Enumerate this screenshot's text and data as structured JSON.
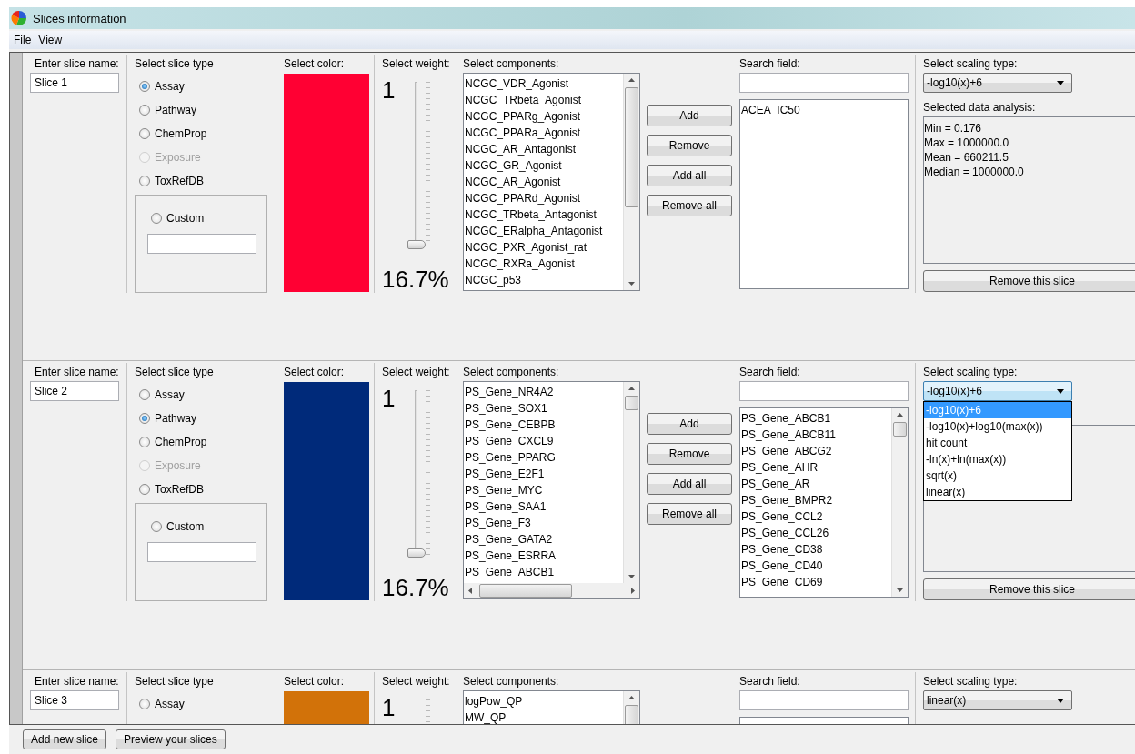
{
  "window": {
    "title": "Slices information"
  },
  "menu": [
    "File",
    "View"
  ],
  "slices": [
    {
      "name_label": "Enter slice name:",
      "name": "Slice 1",
      "type_label": "Select slice type",
      "types": [
        {
          "label": "Assay",
          "selected": true,
          "disabled": false
        },
        {
          "label": "Pathway",
          "selected": false,
          "disabled": false
        },
        {
          "label": "ChemProp",
          "selected": false,
          "disabled": false
        },
        {
          "label": "Exposure",
          "selected": false,
          "disabled": true
        },
        {
          "label": "ToxRefDB",
          "selected": false,
          "disabled": false
        }
      ],
      "custom": {
        "label": "Custom",
        "selected": false
      },
      "color_label": "Select color:",
      "color": "#ff0033",
      "weight_label": "Select weight:",
      "weight": "1",
      "level": 0,
      "percent": "16.7%",
      "components_label": "Select components:",
      "components": [
        "NCGC_VDR_Agonist",
        "NCGC_TRbeta_Agonist",
        "NCGC_PPARg_Agonist",
        "NCGC_PPARa_Agonist",
        "NCGC_AR_Antagonist",
        "NCGC_GR_Agonist",
        "NCGC_AR_Agonist",
        "NCGC_PPARd_Agonist",
        "NCGC_TRbeta_Antagonist",
        "NCGC_ERalpha_Antagonist",
        "NCGC_PXR_Agonist_rat",
        "NCGC_RXRa_Agonist",
        "NCGC_p53"
      ],
      "horizontal_scrollbar": false,
      "buttons": [
        "Add",
        "Remove",
        "Add all",
        "Remove all"
      ],
      "search_label": "Search field:",
      "selected_components": [
        "ACEA_IC50"
      ],
      "selected_scrollbar": false,
      "scaling_label": "Select scaling type:",
      "scaling": "-log10(x)+6",
      "dropdown": {
        "expanded": false
      },
      "analysis_label": "Selected data analysis:",
      "analysis": [
        "Min = 0.176",
        "Max = 1000000.0",
        "Mean = 660211.5",
        "Median = 1000000.0"
      ],
      "remove_button": "Remove this slice"
    },
    {
      "name_label": "Enter slice name:",
      "name": "Slice 2",
      "type_label": "Select slice type",
      "types": [
        {
          "label": "Assay",
          "selected": false,
          "disabled": false
        },
        {
          "label": "Pathway",
          "selected": true,
          "disabled": false
        },
        {
          "label": "ChemProp",
          "selected": false,
          "disabled": false
        },
        {
          "label": "Exposure",
          "selected": false,
          "disabled": true
        },
        {
          "label": "ToxRefDB",
          "selected": false,
          "disabled": false
        }
      ],
      "custom": {
        "label": "Custom",
        "selected": false
      },
      "color_label": "Select color:",
      "color": "#002a7a",
      "weight_label": "Select weight:",
      "weight": "1",
      "level": 0,
      "percent": "16.7%",
      "components_label": "Select components:",
      "components": [
        "PS_Gene_NR4A2",
        "PS_Gene_SOX1",
        "PS_Gene_CEBPB",
        "PS_Gene_CXCL9",
        "PS_Gene_PPARG",
        "PS_Gene_E2F1",
        "PS_Gene_MYC",
        "PS_Gene_SAA1",
        "PS_Gene_F3",
        "PS_Gene_GATA2",
        "PS_Gene_ESRRA",
        "PS_Gene_ABCB1"
      ],
      "horizontal_scrollbar": true,
      "buttons": [
        "Add",
        "Remove",
        "Add all",
        "Remove all"
      ],
      "search_label": "Search field:",
      "selected_components": [
        "PS_Gene_ABCB1",
        "PS_Gene_ABCB11",
        "PS_Gene_ABCG2",
        "PS_Gene_AHR",
        "PS_Gene_AR",
        "PS_Gene_BMPR2",
        "PS_Gene_CCL2",
        "PS_Gene_CCL26",
        "PS_Gene_CD38",
        "PS_Gene_CD40",
        "PS_Gene_CD69"
      ],
      "selected_scrollbar": true,
      "scaling_label": "Select scaling type:",
      "scaling": "-log10(x)+6",
      "dropdown": {
        "expanded": true,
        "options": [
          {
            "label": "-log10(x)+6",
            "selected": true
          },
          {
            "label": "-log10(x)+log10(max(x))",
            "selected": false
          },
          {
            "label": "hit count",
            "selected": false
          },
          {
            "label": "-ln(x)+ln(max(x))",
            "selected": false
          },
          {
            "label": "sqrt(x)",
            "selected": false
          },
          {
            "label": "linear(x)",
            "selected": false
          }
        ]
      },
      "remove_button": "Remove this slice"
    },
    {
      "name_label": "Enter slice name:",
      "name": "Slice 3",
      "type_label": "Select slice type",
      "types": [
        {
          "label": "Assay",
          "selected": false,
          "disabled": false
        }
      ],
      "color_label": "Select color:",
      "color": "#d27209",
      "weight_label": "Select weight:",
      "weight": "1",
      "components_label": "Select components:",
      "components": [
        "logPow_QP",
        "MW_QP"
      ],
      "horizontal_scrollbar": false,
      "search_label": "Search field:",
      "selected_scrollbar": false,
      "scaling_label": "Select scaling type:",
      "scaling": "linear(x)",
      "dropdown": {
        "expanded": false
      }
    }
  ],
  "footer_buttons": [
    "Add new slice",
    "Preview your slices"
  ]
}
